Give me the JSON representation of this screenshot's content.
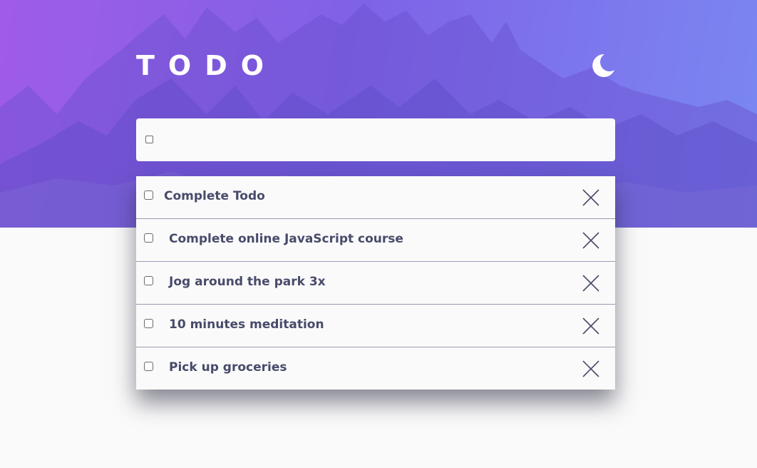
{
  "app": {
    "title": "TODO",
    "theme_icon": "moon-icon"
  },
  "colors": {
    "gradient_start": "#a05ce6",
    "gradient_end": "#7a88f2",
    "page_background": "#fafafa",
    "todo_text": "#484b6a",
    "divider": "#9a9bb3"
  },
  "new_todo": {
    "value": "",
    "placeholder": "",
    "checkbox_checked": false
  },
  "todos": [
    {
      "label": "Complete Todo",
      "checked": false,
      "delete_icon": "close-icon"
    },
    {
      "label": "Complete online JavaScript course",
      "checked": false,
      "delete_icon": "close-icon"
    },
    {
      "label": "Jog around the park 3x",
      "checked": false,
      "delete_icon": "close-icon"
    },
    {
      "label": "10 minutes meditation",
      "checked": false,
      "delete_icon": "close-icon"
    },
    {
      "label": "Pick up groceries",
      "checked": false,
      "delete_icon": "close-icon"
    }
  ]
}
